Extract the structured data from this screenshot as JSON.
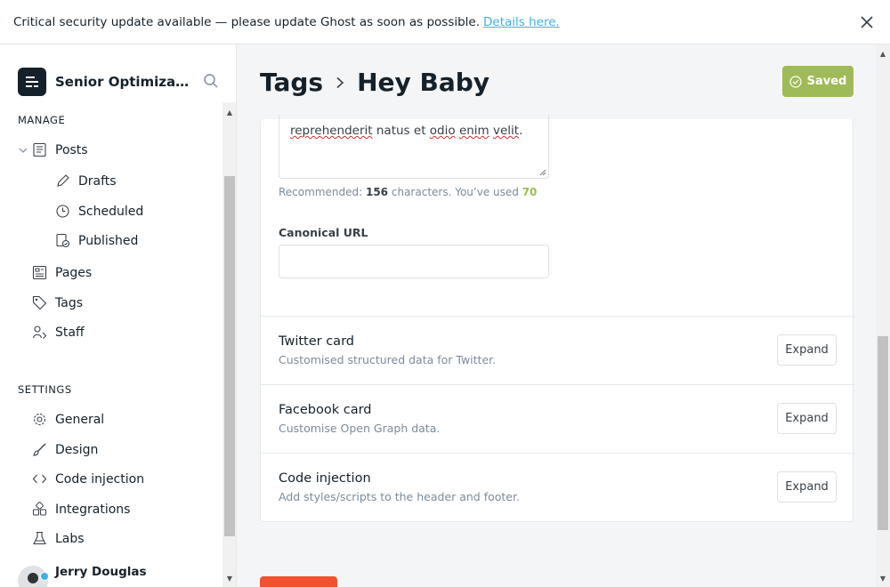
{
  "alert": {
    "message": "Critical security update available — please update Ghost as soon as possible.",
    "link_text": "Details here."
  },
  "sidebar": {
    "site_name": "Senior Optimizatio...",
    "manage_title": "MANAGE",
    "settings_title": "SETTINGS",
    "items": {
      "posts": "Posts",
      "drafts": "Drafts",
      "scheduled": "Scheduled",
      "published": "Published",
      "pages": "Pages",
      "tags": "Tags",
      "staff": "Staff",
      "general": "General",
      "design": "Design",
      "code_injection": "Code injection",
      "integrations": "Integrations",
      "labs": "Labs"
    },
    "user_name": "Jerry Douglas"
  },
  "header": {
    "breadcrumb_parent": "Tags",
    "title": "Hey Baby",
    "saved_label": "Saved"
  },
  "form": {
    "textarea_visible_text_parts": [
      "reprehenderit",
      "natus",
      "et",
      "odio",
      "enim",
      "velit",
      "."
    ],
    "hint_prefix": "Recommended:",
    "hint_recommended": "156",
    "hint_middle": "characters. You’ve used",
    "hint_used": "70",
    "canonical_label": "Canonical URL",
    "canonical_value": ""
  },
  "cards": [
    {
      "title": "Twitter card",
      "subtitle": "Customised structured data for Twitter.",
      "button": "Expand"
    },
    {
      "title": "Facebook card",
      "subtitle": "Customise Open Graph data.",
      "button": "Expand"
    },
    {
      "title": "Code injection",
      "subtitle": "Add styles/scripts to the header and footer.",
      "button": "Expand"
    }
  ],
  "colors": {
    "accent_green": "#9fbb58",
    "link_blue": "#3eb0ef",
    "danger_red": "#f05230",
    "dark": "#15212a"
  }
}
